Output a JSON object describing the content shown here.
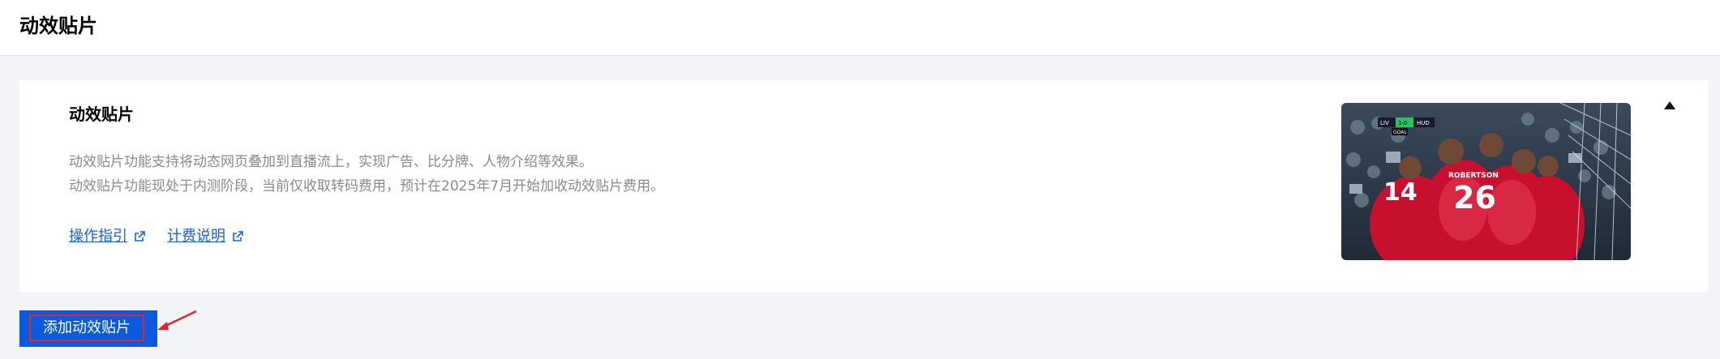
{
  "header": {
    "title": "动效贴片"
  },
  "card": {
    "title": "动效贴片",
    "description": [
      "动效贴片功能支持将动态网页叠加到直播流上，实现广告、比分牌、人物介绍等效果。",
      "动效贴片功能现处于内测阶段，当前仅收取转码费用，预计在2025年7月开始加收动效贴片费用。"
    ],
    "links": {
      "guide": "操作指引",
      "billing": "计费说明"
    },
    "preview": {
      "score_home": "LIV",
      "score": "1-0",
      "score_away": "HUD",
      "banner": "GOAL",
      "player_name": "ROBERTSON",
      "player_number": "26",
      "other_number": "14"
    },
    "collapse_icon": "triangle-up-icon"
  },
  "actions": {
    "add_label": "添加动效贴片"
  },
  "colors": {
    "accent": "#0a5ae0",
    "link": "#1561e8",
    "highlight_box": "#e3262c"
  }
}
